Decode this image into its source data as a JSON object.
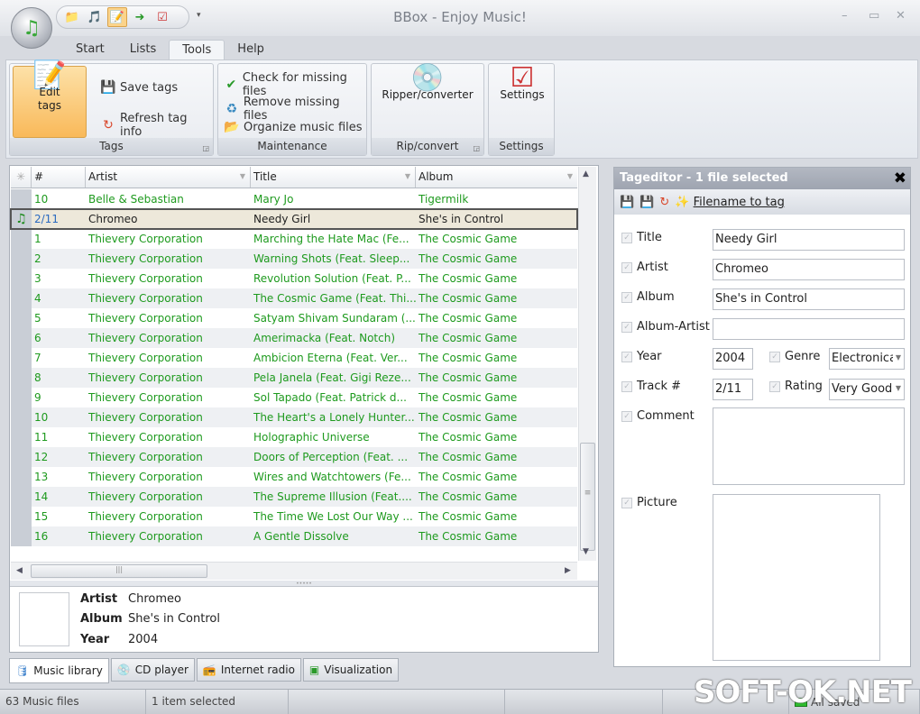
{
  "window": {
    "title": "BBox - Enjoy Music!",
    "minimize": "–",
    "maximize": "▭",
    "close": "✕"
  },
  "qat": {
    "icons": [
      "music-folder-icon",
      "music-file-icon",
      "edit-tags-icon",
      "ripper-icon",
      "settings-icon"
    ],
    "more": "▾"
  },
  "menu_tabs": [
    {
      "label": "Start"
    },
    {
      "label": "Lists"
    },
    {
      "label": "Tools",
      "active": true
    },
    {
      "label": "Help"
    }
  ],
  "ribbon": {
    "tags": {
      "label": "Tags",
      "edit_tags": "Edit tags",
      "save_tags": "Save tags",
      "refresh": "Refresh tag info"
    },
    "maintenance": {
      "label": "Maintenance",
      "check": "Check for missing files",
      "remove": "Remove missing files",
      "organize": "Organize music files"
    },
    "rip": {
      "label": "Rip/convert",
      "ripper": "Ripper/converter"
    },
    "settings": {
      "label": "Settings",
      "settings": "Settings"
    }
  },
  "grid": {
    "columns": [
      "#",
      "Artist",
      "Title",
      "Album"
    ],
    "rows": [
      [
        "10",
        "Belle & Sebastian",
        "Mary Jo",
        "Tigermilk"
      ],
      [
        "2/11",
        "Chromeo",
        "Needy Girl",
        "She's in Control"
      ],
      [
        "1",
        "Thievery Corporation",
        "Marching the Hate Mac (Fe...",
        "The Cosmic Game"
      ],
      [
        "2",
        "Thievery Corporation",
        "Warning Shots (Feat. Sleep...",
        "The Cosmic Game"
      ],
      [
        "3",
        "Thievery Corporation",
        "Revolution Solution (Feat. P...",
        "The Cosmic Game"
      ],
      [
        "4",
        "Thievery Corporation",
        "The Cosmic Game (Feat. Thi...",
        "The Cosmic Game"
      ],
      [
        "5",
        "Thievery Corporation",
        "Satyam Shivam Sundaram (...",
        "The Cosmic Game"
      ],
      [
        "6",
        "Thievery Corporation",
        "Amerimacka (Feat. Notch)",
        "The Cosmic Game"
      ],
      [
        "7",
        "Thievery Corporation",
        "Ambicion Eterna (Feat. Ver...",
        "The Cosmic Game"
      ],
      [
        "8",
        "Thievery Corporation",
        "Pela Janela (Feat. Gigi Reze...",
        "The Cosmic Game"
      ],
      [
        "9",
        "Thievery Corporation",
        "Sol Tapado (Feat. Patrick d...",
        "The Cosmic Game"
      ],
      [
        "10",
        "Thievery Corporation",
        "The Heart's a Lonely Hunter...",
        "The Cosmic Game"
      ],
      [
        "11",
        "Thievery Corporation",
        "Holographic Universe",
        "The Cosmic Game"
      ],
      [
        "12",
        "Thievery Corporation",
        "Doors of Perception (Feat. ...",
        "The Cosmic Game"
      ],
      [
        "13",
        "Thievery Corporation",
        "Wires and Watchtowers (Fe...",
        "The Cosmic Game"
      ],
      [
        "14",
        "Thievery Corporation",
        "The Supreme Illusion (Feat....",
        "The Cosmic Game"
      ],
      [
        "15",
        "Thievery Corporation",
        "The Time We Lost Our Way ...",
        "The Cosmic Game"
      ],
      [
        "16",
        "Thievery Corporation",
        "A Gentle Dissolve",
        "The Cosmic Game"
      ]
    ],
    "selected_row": 1,
    "playing_row": 1
  },
  "info": {
    "artist_label": "Artist",
    "artist": "Chromeo",
    "album_label": "Album",
    "album": "She's in Control",
    "year_label": "Year",
    "year": "2004"
  },
  "bottom_tabs": [
    {
      "label": "Music library",
      "icon": "database-icon",
      "active": true
    },
    {
      "label": "CD player",
      "icon": "cd-icon"
    },
    {
      "label": "Internet radio",
      "icon": "radio-icon"
    },
    {
      "label": "Visualization",
      "icon": "visualization-icon"
    }
  ],
  "tageditor": {
    "title": "Tageditor - 1 file selected",
    "filename_to_tag": "Filename to tag",
    "fields": {
      "title_label": "Title",
      "title": "Needy Girl",
      "artist_label": "Artist",
      "artist": "Chromeo",
      "album_label": "Album",
      "album": "She's in Control",
      "album_artist_label": "Album-Artist",
      "album_artist": "",
      "year_label": "Year",
      "year": "2004",
      "genre_label": "Genre",
      "genre": "Electronica",
      "track_label": "Track #",
      "track": "2/11",
      "rating_label": "Rating",
      "rating": "Very Good",
      "comment_label": "Comment",
      "comment": "",
      "picture_label": "Picture"
    }
  },
  "status": {
    "files": "63 Music files",
    "selected": "1 item selected",
    "saved": "All saved"
  },
  "watermark": "SOFT-OK.NET",
  "colors": {
    "green_text": "#1e9a1e",
    "accent_orange": "#fbc46a"
  }
}
